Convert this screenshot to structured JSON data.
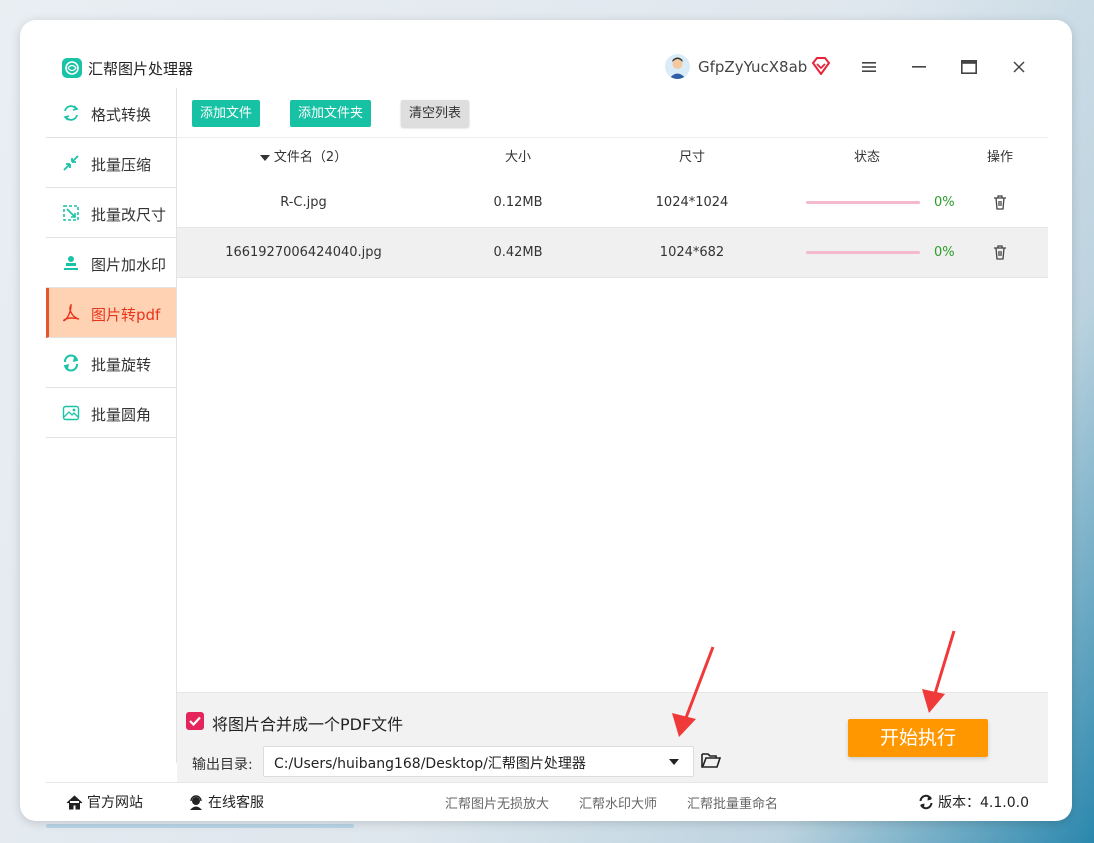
{
  "app": {
    "title": "汇帮图片处理器",
    "username": "GfpZyYucX8ab"
  },
  "sidebar": {
    "items": [
      {
        "label": "格式转换",
        "icon": "format-convert-icon"
      },
      {
        "label": "批量压缩",
        "icon": "compress-icon"
      },
      {
        "label": "批量改尺寸",
        "icon": "resize-icon"
      },
      {
        "label": "图片加水印",
        "icon": "watermark-icon"
      },
      {
        "label": "图片转pdf",
        "icon": "pdf-icon",
        "active": true
      },
      {
        "label": "批量旋转",
        "icon": "rotate-icon"
      },
      {
        "label": "批量圆角",
        "icon": "rounded-corner-icon"
      }
    ]
  },
  "toolbar": {
    "add_file": "添加文件",
    "add_folder": "添加文件夹",
    "clear_list": "清空列表"
  },
  "table": {
    "headers": {
      "name": "文件名（2）",
      "size": "大小",
      "dimension": "尺寸",
      "status": "状态",
      "action": "操作"
    },
    "rows": [
      {
        "name": "R-C.jpg",
        "size": "0.12MB",
        "dimension": "1024*1024",
        "progress": "0%"
      },
      {
        "name": "1661927006424040.jpg",
        "size": "0.42MB",
        "dimension": "1024*682",
        "progress": "0%"
      }
    ]
  },
  "options": {
    "merge_label": "将图片合并成一个PDF文件",
    "merge_checked": true,
    "output_label": "输出目录:",
    "output_path": "C:/Users/huibang168/Desktop/汇帮图片处理器",
    "start_button": "开始执行"
  },
  "footer": {
    "official_site": "官方网站",
    "online_service": "在线客服",
    "links": [
      "汇帮图片无损放大",
      "汇帮水印大师",
      "汇帮批量重命名"
    ],
    "version": "版本：4.1.0.0"
  },
  "colors": {
    "accent_green": "#17c2a4",
    "active_red": "#e9341c",
    "start_orange": "#ff9800",
    "checkbox_pink": "#e5245c"
  }
}
